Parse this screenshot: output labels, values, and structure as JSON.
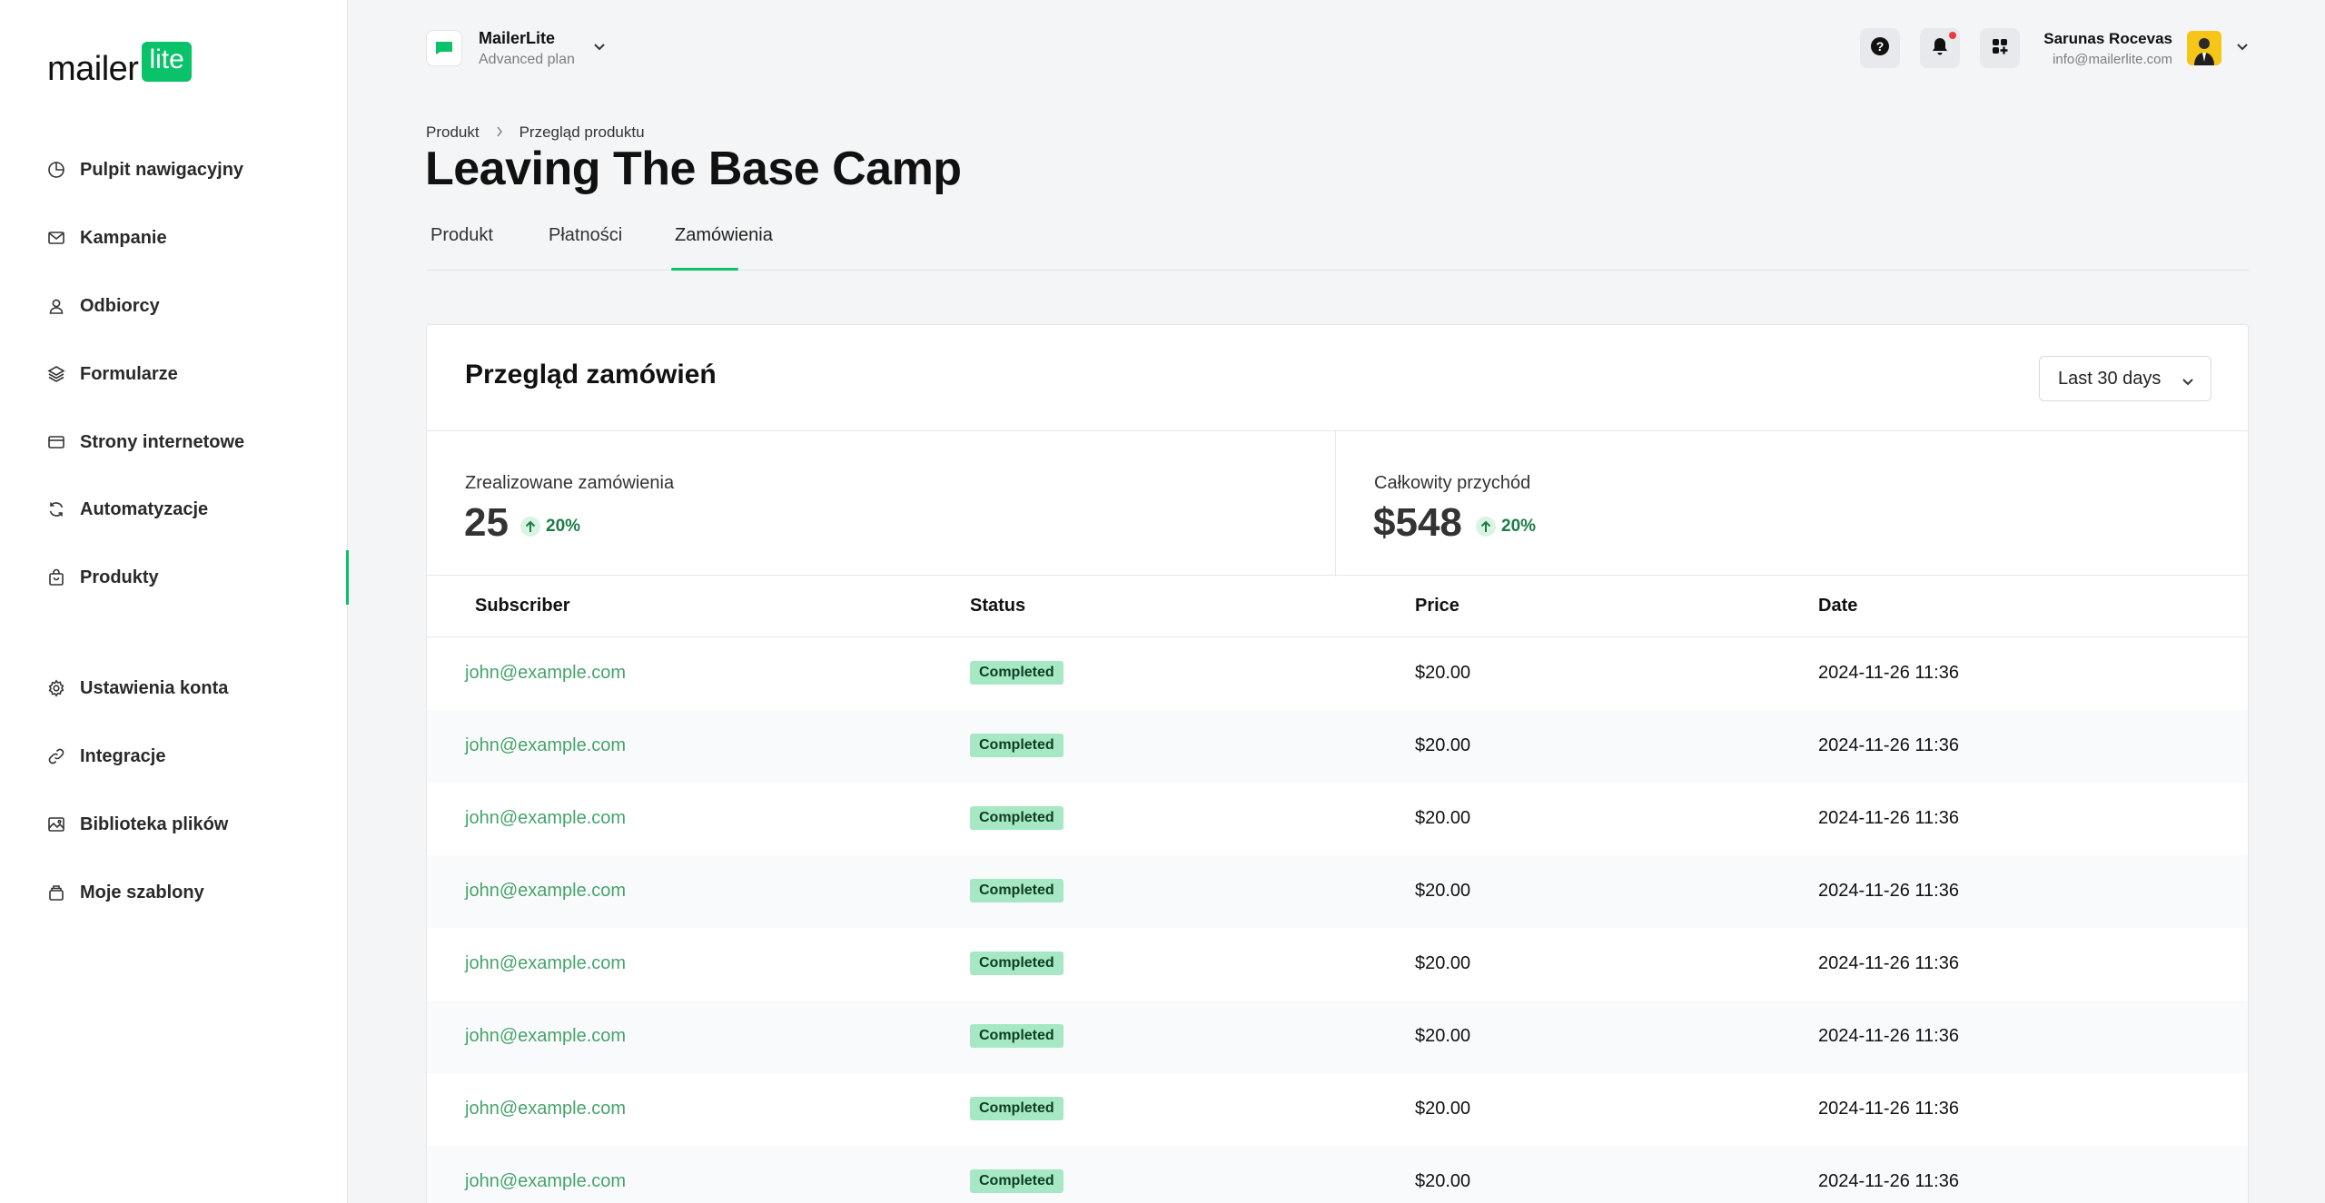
{
  "brand": {
    "word": "mailer",
    "badge": "lite"
  },
  "sidebar": {
    "items": [
      {
        "label": "Pulpit nawigacyjny",
        "icon": "dashboard-icon"
      },
      {
        "label": "Kampanie",
        "icon": "mail-icon"
      },
      {
        "label": "Odbiorcy",
        "icon": "user-icon"
      },
      {
        "label": "Formularze",
        "icon": "layers-icon"
      },
      {
        "label": "Strony internetowe",
        "icon": "browser-icon"
      },
      {
        "label": "Automatyzacje",
        "icon": "refresh-icon"
      },
      {
        "label": "Produkty",
        "icon": "bag-icon"
      },
      {
        "label": "Ustawienia konta",
        "icon": "gear-icon"
      },
      {
        "label": "Integracje",
        "icon": "link-icon"
      },
      {
        "label": "Biblioteka plików",
        "icon": "image-icon"
      },
      {
        "label": "Moje szablony",
        "icon": "stack-icon"
      }
    ],
    "active": "Produkty"
  },
  "account": {
    "name": "MailerLite",
    "plan": "Advanced plan"
  },
  "user": {
    "name": "Sarunas Rocevas",
    "email": "info@mailerlite.com"
  },
  "breadcrumb": {
    "parent": "Produkt",
    "current": "Przegląd produktu"
  },
  "page": {
    "title": "Leaving The Base Camp"
  },
  "tabs": [
    {
      "label": "Produkt"
    },
    {
      "label": "Płatności"
    },
    {
      "label": "Zamówienia"
    }
  ],
  "activeTab": "Zamówienia",
  "card": {
    "title": "Przegląd zamówień",
    "range": "Last 30 days"
  },
  "stats": [
    {
      "label": "Zrealizowane zamówienia",
      "value": "25",
      "delta": "20%"
    },
    {
      "label": "Całkowity przychód",
      "value": "$548",
      "delta": "20%"
    }
  ],
  "table": {
    "headers": {
      "subscriber": "Subscriber",
      "status": "Status",
      "price": "Price",
      "date": "Date"
    },
    "rows": [
      {
        "subscriber": "john@example.com",
        "status": "Completed",
        "price": "$20.00",
        "date": "2024-11-26 11:36"
      },
      {
        "subscriber": "john@example.com",
        "status": "Completed",
        "price": "$20.00",
        "date": "2024-11-26 11:36"
      },
      {
        "subscriber": "john@example.com",
        "status": "Completed",
        "price": "$20.00",
        "date": "2024-11-26 11:36"
      },
      {
        "subscriber": "john@example.com",
        "status": "Completed",
        "price": "$20.00",
        "date": "2024-11-26 11:36"
      },
      {
        "subscriber": "john@example.com",
        "status": "Completed",
        "price": "$20.00",
        "date": "2024-11-26 11:36"
      },
      {
        "subscriber": "john@example.com",
        "status": "Completed",
        "price": "$20.00",
        "date": "2024-11-26 11:36"
      },
      {
        "subscriber": "john@example.com",
        "status": "Completed",
        "price": "$20.00",
        "date": "2024-11-26 11:36"
      },
      {
        "subscriber": "john@example.com",
        "status": "Completed",
        "price": "$20.00",
        "date": "2024-11-26 11:36"
      }
    ]
  },
  "colors": {
    "accent": "#09c269",
    "link": "#46a36c",
    "badge": "#a6e8c4"
  }
}
